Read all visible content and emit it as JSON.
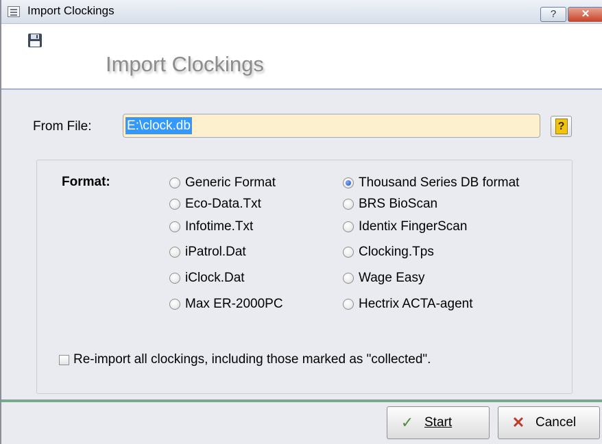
{
  "window": {
    "title": "Import Clockings",
    "help_label": "?",
    "close_label": "✕"
  },
  "header": {
    "title": "Import Clockings"
  },
  "file": {
    "label": "From File:",
    "value": "E:\\clock.db",
    "help_label": "?"
  },
  "format": {
    "label": "Format:",
    "options": [
      {
        "label": "Generic Format",
        "checked": false
      },
      {
        "label": "Eco-Data.Txt",
        "checked": false
      },
      {
        "label": "Infotime.Txt",
        "checked": false
      },
      {
        "label": "iPatrol.Dat",
        "checked": false
      },
      {
        "label": "iClock.Dat",
        "checked": false
      },
      {
        "label": "Max ER-2000PC",
        "checked": false
      },
      {
        "label": "Thousand Series DB format",
        "checked": true
      },
      {
        "label": "BRS BioScan",
        "checked": false
      },
      {
        "label": "Identix FingerScan",
        "checked": false
      },
      {
        "label": "Clocking.Tps",
        "checked": false
      },
      {
        "label": "Wage Easy",
        "checked": false
      },
      {
        "label": "Hectrix ACTA-agent",
        "checked": false
      }
    ]
  },
  "reimport": {
    "label": "Re-import all clockings, including those marked as \"collected\".",
    "checked": false
  },
  "buttons": {
    "start_label": "Start",
    "start_icon": "✓",
    "cancel_label": "Cancel",
    "cancel_icon": "✕"
  }
}
